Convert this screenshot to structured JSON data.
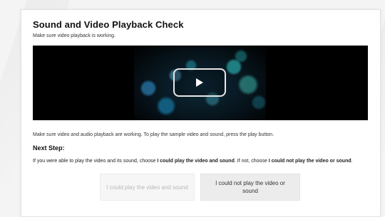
{
  "page": {
    "title": "Sound and Video Playback Check",
    "subtitle": "Make sure video playback is working."
  },
  "video": {
    "play_icon": "play-icon"
  },
  "instructions": "Make sure video and audio playback are working. To play the sample video and sound, press the play button.",
  "next_step": {
    "heading": "Next Step:",
    "text_part1": "If you were able to play the video and its sound, choose ",
    "text_bold1": "I could play the video and sound",
    "text_part2": ". If not, choose ",
    "text_bold2": "I could not play the video or sound",
    "text_part3": "."
  },
  "buttons": {
    "could_play": "I could play the video and sound",
    "could_not_play": "I could not play the video or sound"
  },
  "colors": {
    "card_bg": "#ffffff",
    "page_bg": "#f4f4f4",
    "player_bg": "#000000",
    "disabled_text": "#b8b8b8"
  }
}
